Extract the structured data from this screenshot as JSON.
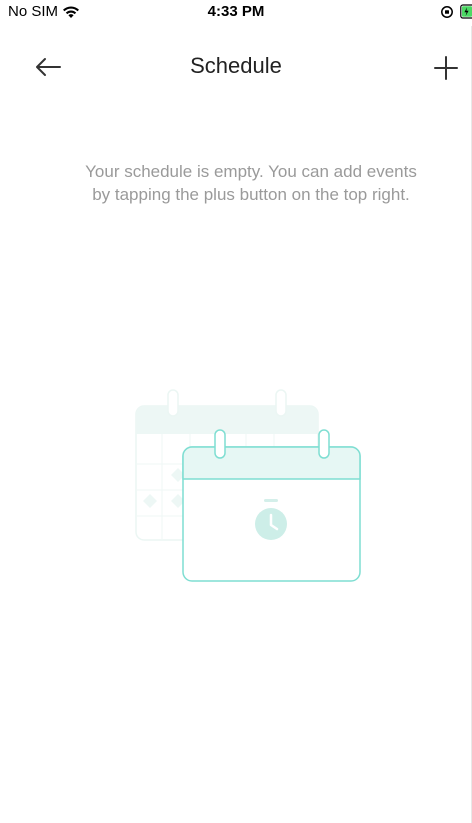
{
  "status_bar": {
    "carrier": "No SIM",
    "time": "4:33 PM"
  },
  "nav": {
    "title": "Schedule",
    "back_icon": "arrow-left-icon",
    "add_icon": "plus-icon"
  },
  "empty_state": {
    "message": "Your schedule is empty. You can add events by tapping the plus button on the top right.",
    "illustration_icon": "calendar-timer-icon"
  },
  "colors": {
    "accent": "#7fded2",
    "accent_light": "#e6f7f4",
    "muted_text": "#9a9a9a",
    "battery": "#4cd964"
  }
}
